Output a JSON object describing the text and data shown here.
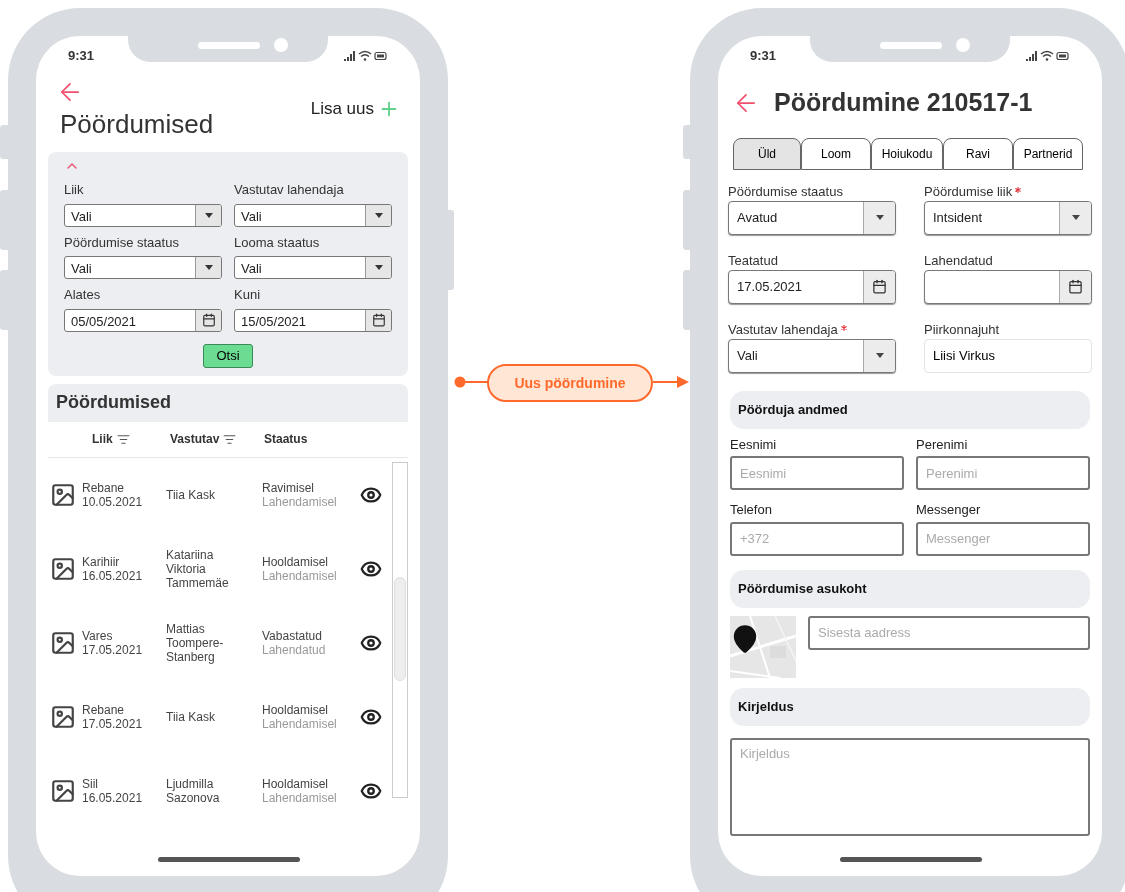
{
  "list_screen": {
    "status_time": "9:31",
    "title": "Pöördumised",
    "add_button": "Lisa uus",
    "filters": {
      "expanded": true,
      "search_button": "Otsi",
      "fields": [
        {
          "kind": "select",
          "label": "Liik",
          "value": "Vali"
        },
        {
          "kind": "select",
          "label": "Vastutav lahendaja",
          "value": "Vali"
        },
        {
          "kind": "select",
          "label": "Pöördumise staatus",
          "value": "Vali"
        },
        {
          "kind": "select",
          "label": "Looma staatus",
          "value": "Vali"
        },
        {
          "kind": "date",
          "label": "Alates",
          "value": "05/05/2021"
        },
        {
          "kind": "date",
          "label": "Kuni",
          "value": "15/05/2021"
        }
      ]
    },
    "results_title": "Pöördumised",
    "columns": [
      {
        "label": "Liik",
        "filter": true
      },
      {
        "label": "Vastutav",
        "filter": true
      },
      {
        "label": "Staatus",
        "filter": false
      }
    ],
    "rows": [
      {
        "animal": "Rebane",
        "date": "10.05.2021",
        "responsible": "Tiia Kask",
        "status": "Ravimisel",
        "resolution": "Lahendamisel"
      },
      {
        "animal": "Karihiir",
        "date": "16.05.2021",
        "responsible": "Katariina Viktoria Tammemäe",
        "status": "Hooldamisel",
        "resolution": "Lahendamisel"
      },
      {
        "animal": "Vares",
        "date": "17.05.2021",
        "responsible": "Mattias Toompere-Stanberg",
        "status": "Vabastatud",
        "resolution": "Lahendatud"
      },
      {
        "animal": "Rebane",
        "date": "17.05.2021",
        "responsible": "Tiia Kask",
        "status": "Hooldamisel",
        "resolution": "Lahendamisel"
      },
      {
        "animal": "Siil",
        "date": "16.05.2021",
        "responsible": "Ljudmilla Sazonova",
        "status": "Hooldamisel",
        "resolution": "Lahendamisel"
      }
    ]
  },
  "flow": {
    "label": "Uus pöördumine"
  },
  "detail_screen": {
    "status_time": "9:31",
    "title": "Pöördumine 210517-1",
    "tabs": [
      {
        "label": "Üld",
        "selected": true
      },
      {
        "label": "Loom",
        "selected": false
      },
      {
        "label": "Hoiukodu",
        "selected": false
      },
      {
        "label": "Ravi",
        "selected": false
      },
      {
        "label": "Partnerid",
        "selected": false
      }
    ],
    "fields": [
      {
        "kind": "select",
        "label": "Pöördumise staatus",
        "required": false,
        "value": "Avatud"
      },
      {
        "kind": "select",
        "label": "Pöördumise liik",
        "required": true,
        "value": "Intsident"
      },
      {
        "kind": "date",
        "label": "Teatatud",
        "required": false,
        "value": "17.05.2021"
      },
      {
        "kind": "date",
        "label": "Lahendatud",
        "required": false
      },
      {
        "kind": "select",
        "label": "Vastutav lahendaja",
        "required": true,
        "value": "Vali"
      },
      {
        "kind": "text",
        "label": "Piirkonnajuht",
        "required": false,
        "value": "Liisi Virkus"
      }
    ],
    "contact": {
      "title": "Pöörduja andmed",
      "fields": [
        {
          "label": "Eesnimi",
          "placeholder": "Eesnimi"
        },
        {
          "label": "Perenimi",
          "placeholder": "Perenimi"
        },
        {
          "label": "Telefon",
          "placeholder": "+372"
        },
        {
          "label": "Messenger",
          "placeholder": "Messenger"
        }
      ]
    },
    "location": {
      "title": "Pöördumise asukoht",
      "address_placeholder": "Sisesta aadress"
    },
    "description": {
      "title": "Kirjeldus",
      "placeholder": "Kirjeldus"
    }
  }
}
